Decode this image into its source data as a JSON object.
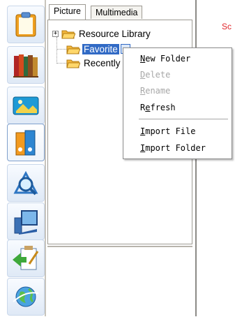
{
  "toolbar": {
    "buttons": [
      {
        "icon": "clipboard-icon"
      },
      {
        "icon": "books-icon"
      },
      {
        "icon": "picture-icon"
      },
      {
        "icon": "binders-icon"
      },
      {
        "icon": "magnifier-icon"
      },
      {
        "icon": "computer-icon"
      },
      {
        "icon": "edit-note-icon"
      },
      {
        "icon": "globe-icon"
      }
    ]
  },
  "panel": {
    "tabs": [
      {
        "label": "Picture"
      },
      {
        "label": "Multimedia"
      }
    ],
    "tree": [
      {
        "label": "Resource Library",
        "expander": "+"
      },
      {
        "label": "Favorite",
        "selected": true
      },
      {
        "label": "Recently"
      }
    ]
  },
  "context_menu": {
    "items": [
      {
        "mnemonic": "N",
        "rest": "ew Folder",
        "enabled": true
      },
      {
        "mnemonic": "D",
        "rest": "elete",
        "enabled": false
      },
      {
        "mnemonic": "R",
        "rest": "ename",
        "enabled": false
      },
      {
        "mnemonic": "Re",
        "rest": "",
        "enabled": true
      },
      {
        "mnemonic": "I",
        "rest": "",
        "enabled": true
      },
      {
        "mnemonic": "I",
        "rest": "",
        "enabled": true
      }
    ],
    "labels": {
      "new_folder_m": "N",
      "new_folder_r": "ew Folder",
      "delete_m": "D",
      "delete_r": "elete",
      "rename_m": "R",
      "rename_r": "ename",
      "refresh_a": "R",
      "refresh_m": "e",
      "refresh_r": "fresh",
      "import_file_m": "I",
      "import_file_r": "mport File",
      "import_folder_m": "I",
      "import_folder_r": "mport Folder"
    }
  },
  "background": {
    "partial_text": "Sc"
  },
  "colors": {
    "selection": "#316ac5",
    "accent_text": "#e0262b",
    "disabled_text": "#a7a7a7"
  }
}
